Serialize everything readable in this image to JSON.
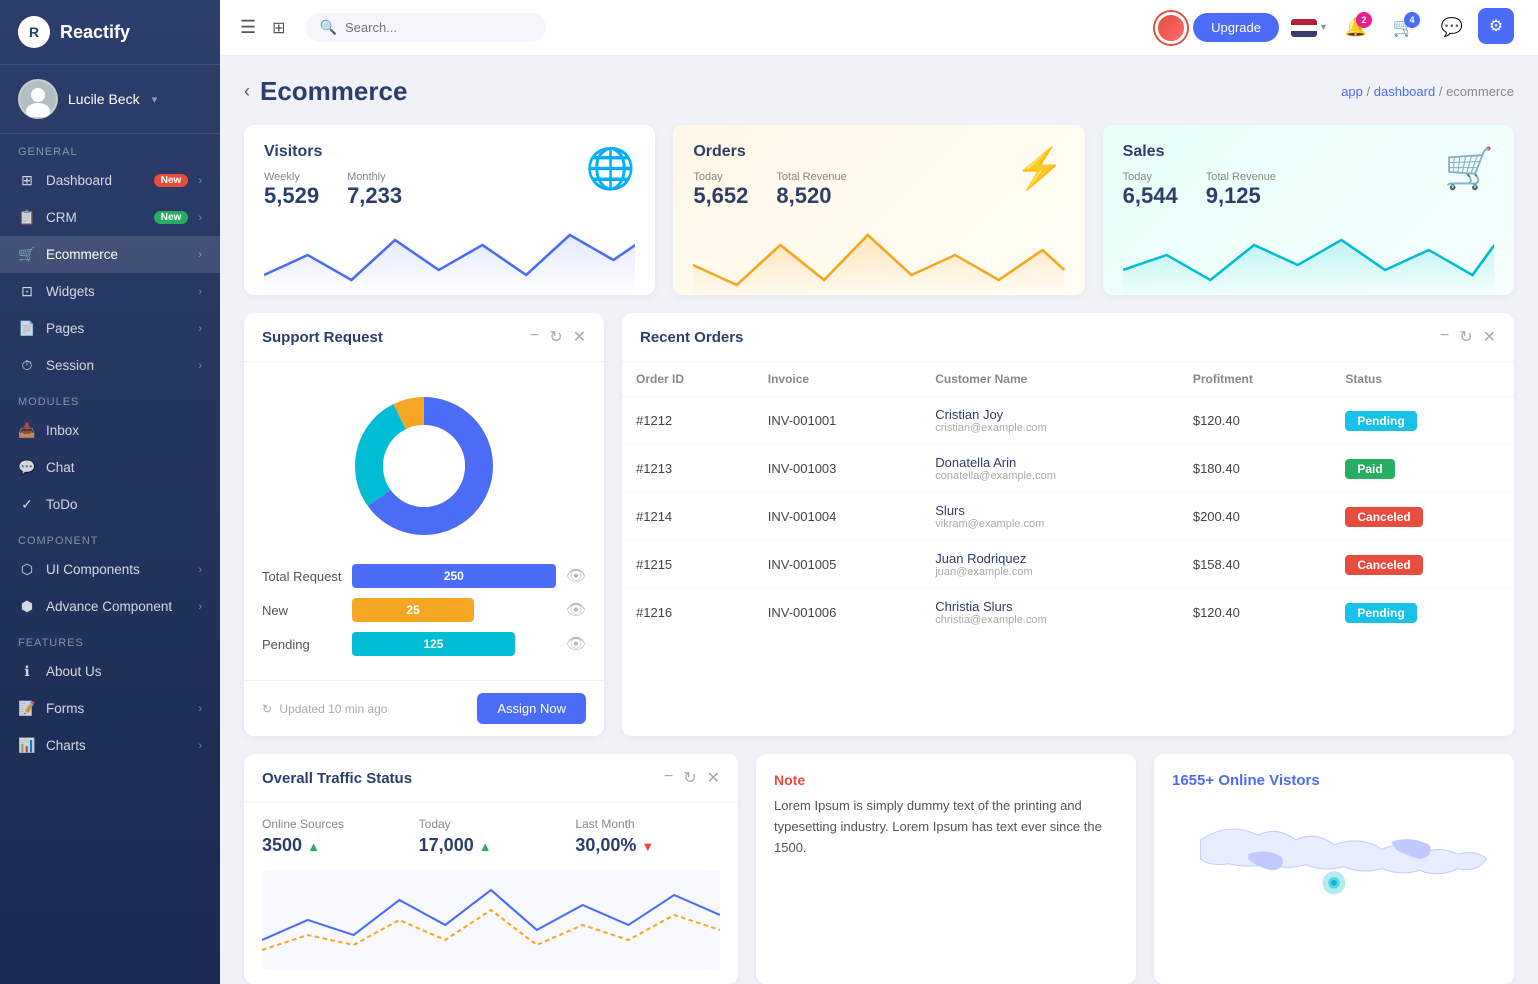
{
  "app": {
    "name": "Reactify",
    "logo_letter": "R"
  },
  "user": {
    "name": "Lucile Beck"
  },
  "topbar": {
    "search_placeholder": "Search...",
    "upgrade_label": "Upgrade",
    "notification_count": "2",
    "cart_count": "4"
  },
  "breadcrumb": {
    "app": "app",
    "dashboard": "dashboard",
    "current": "ecommerce"
  },
  "page": {
    "title": "Ecommerce"
  },
  "sidebar": {
    "general_label": "General",
    "modules_label": "Modules",
    "component_label": "Component",
    "features_label": "Features",
    "items": [
      {
        "id": "dashboard",
        "label": "Dashboard",
        "badge": "New",
        "badge_color": "badge-red",
        "has_arrow": true
      },
      {
        "id": "crm",
        "label": "CRM",
        "badge": "New",
        "badge_color": "badge-green",
        "has_arrow": true
      },
      {
        "id": "ecommerce",
        "label": "Ecommerce",
        "badge": "",
        "has_arrow": true,
        "active": true
      },
      {
        "id": "widgets",
        "label": "Widgets",
        "badge": "",
        "has_arrow": true
      },
      {
        "id": "pages",
        "label": "Pages",
        "badge": "",
        "has_arrow": true
      },
      {
        "id": "session",
        "label": "Session",
        "badge": "",
        "has_arrow": true
      }
    ],
    "module_items": [
      {
        "id": "inbox",
        "label": "Inbox"
      },
      {
        "id": "chat",
        "label": "Chat"
      },
      {
        "id": "todo",
        "label": "ToDo"
      }
    ],
    "component_items": [
      {
        "id": "ui-components",
        "label": "UI Components",
        "has_arrow": true
      },
      {
        "id": "advance-component",
        "label": "Advance Component",
        "has_arrow": true
      }
    ],
    "feature_items": [
      {
        "id": "about-us",
        "label": "About Us"
      },
      {
        "id": "forms",
        "label": "Forms",
        "has_arrow": true
      },
      {
        "id": "charts",
        "label": "Charts",
        "has_arrow": true
      }
    ]
  },
  "visitors": {
    "title": "Visitors",
    "weekly_label": "Weekly",
    "weekly_value": "5,529",
    "monthly_label": "Monthly",
    "monthly_value": "7,233",
    "icon": "🌐"
  },
  "orders": {
    "title": "Orders",
    "today_label": "Today",
    "today_value": "5,652",
    "revenue_label": "Total Revenue",
    "revenue_value": "8,520",
    "icon": "⚡"
  },
  "sales": {
    "title": "Sales",
    "today_label": "Today",
    "today_value": "6,544",
    "revenue_label": "Total Revenue",
    "revenue_value": "9,125",
    "icon": "🛒"
  },
  "support": {
    "title": "Support Request",
    "total_label": "Total Request",
    "total_value": "250",
    "new_label": "New",
    "new_value": "25",
    "pending_label": "Pending",
    "pending_value": "125",
    "updated_text": "Updated 10 min ago",
    "assign_btn": "Assign Now"
  },
  "recent_orders": {
    "title": "Recent Orders",
    "columns": [
      "Order ID",
      "Invoice",
      "Customer Name",
      "Profitment",
      "Status"
    ],
    "rows": [
      {
        "id": "#1212",
        "invoice": "INV-001001",
        "name": "Cristian Joy",
        "email": "cristian@example.com",
        "profit": "$120.40",
        "status": "Pending",
        "status_class": "status-pending"
      },
      {
        "id": "#1213",
        "invoice": "INV-001003",
        "name": "Donatella Arin",
        "email": "conatella@example.com",
        "profit": "$180.40",
        "status": "Paid",
        "status_class": "status-paid"
      },
      {
        "id": "#1214",
        "invoice": "INV-001004",
        "name": "Slurs",
        "email": "vikram@example.com",
        "profit": "$200.40",
        "status": "Canceled",
        "status_class": "status-canceled"
      },
      {
        "id": "#1215",
        "invoice": "INV-001005",
        "name": "Juan Rodriquez",
        "email": "juan@example.com",
        "profit": "$158.40",
        "status": "Canceled",
        "status_class": "status-canceled"
      },
      {
        "id": "#1216",
        "invoice": "INV-001006",
        "name": "Christia Slurs",
        "email": "christia@example.com",
        "profit": "$120.40",
        "status": "Pending",
        "status_class": "status-pending"
      }
    ]
  },
  "traffic": {
    "title": "Overall Traffic Status",
    "col1_label": "Online Sources",
    "col1_value": "3500",
    "col1_arrow": "up",
    "col2_label": "Today",
    "col2_value": "17,000",
    "col2_arrow": "up",
    "col3_label": "Last Month",
    "col3_value": "30,00%",
    "col3_arrow": "down"
  },
  "note": {
    "title": "Note",
    "text": "Lorem Ipsum is simply dummy text of the printing and typesetting industry. Lorem Ipsum has text ever since the 1500."
  },
  "online": {
    "count": "1655+",
    "label": "Online Vistors"
  }
}
